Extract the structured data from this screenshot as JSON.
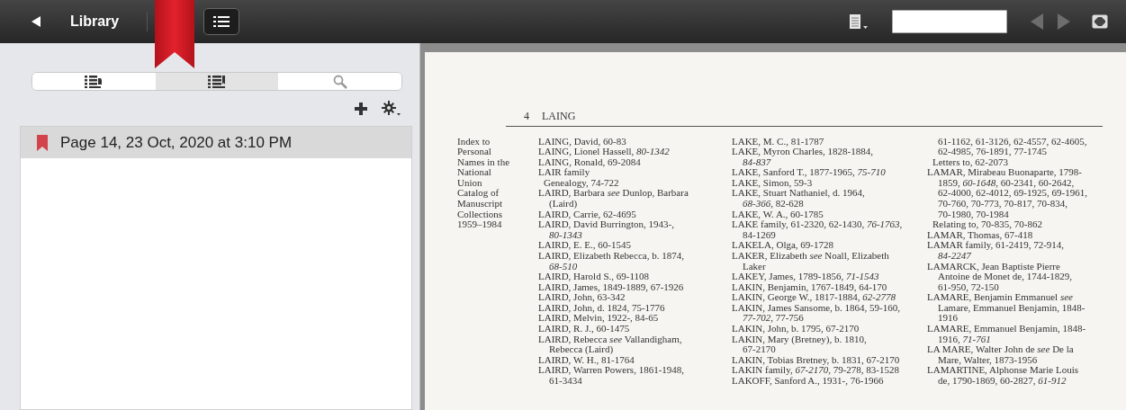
{
  "toolbar": {
    "title": "Library",
    "bookmark_ribbon": true,
    "nav_buttons": [
      {
        "kind": "prev",
        "disabled": true
      },
      {
        "kind": "next",
        "disabled": true
      }
    ]
  },
  "sidebar": {
    "tabs": [
      {
        "kind": "contents",
        "selected": false
      },
      {
        "kind": "bookmarks",
        "selected": true
      },
      {
        "kind": "search",
        "selected": false
      }
    ],
    "bookmarks": [
      {
        "label": "Page 14, 23 Oct, 2020 at 3:10 PM",
        "selected": true
      }
    ]
  },
  "page": {
    "running_head": {
      "number": "4",
      "word": "LAING"
    },
    "margin_note": [
      "Index to",
      "Personal",
      "Names in the",
      "National",
      "Union",
      "Catalog of",
      "Manuscript",
      "Collections",
      "1959–1984"
    ],
    "columns": [
      [
        {
          "kind": "entry",
          "lines": [
            "LAING, David, 60-83"
          ]
        },
        {
          "kind": "entry",
          "lines": [
            "LAING, Lionel Hassell, *80-1342*"
          ]
        },
        {
          "kind": "entry",
          "lines": [
            "LAING, Ronald, 69-2084"
          ]
        },
        {
          "kind": "entry",
          "lines": [
            "LAIR family"
          ]
        },
        {
          "kind": "sub",
          "lines": [
            "Genealogy, 74-722"
          ]
        },
        {
          "kind": "entry",
          "lines": [
            "LAIRD, Barbara *see* Dunlop, Barbara",
            "(Laird)"
          ]
        },
        {
          "kind": "entry",
          "lines": [
            "LAIRD, Carrie, 62-4695"
          ]
        },
        {
          "kind": "entry",
          "lines": [
            "LAIRD, David Burrington, 1943-,",
            "*80-1343*"
          ]
        },
        {
          "kind": "entry",
          "lines": [
            "LAIRD, E. E., 60-1545"
          ]
        },
        {
          "kind": "entry",
          "lines": [
            "LAIRD, Elizabeth Rebecca, b. 1874,",
            "*68-510*"
          ]
        },
        {
          "kind": "entry",
          "lines": [
            "LAIRD, Harold S., 69-1108"
          ]
        },
        {
          "kind": "entry",
          "lines": [
            "LAIRD, James, 1849-1889, 67-1926"
          ]
        },
        {
          "kind": "entry",
          "lines": [
            "LAIRD, John, 63-342"
          ]
        },
        {
          "kind": "entry",
          "lines": [
            "LAIRD, John, d. 1824, 75-1776"
          ]
        },
        {
          "kind": "entry",
          "lines": [
            "LAIRD, Melvin, 1922-, 84-65"
          ]
        },
        {
          "kind": "entry",
          "lines": [
            "LAIRD, R. J., 60-1475"
          ]
        },
        {
          "kind": "entry",
          "lines": [
            "LAIRD, Rebecca *see* Vallandigham,",
            "Rebecca (Laird)"
          ]
        },
        {
          "kind": "entry",
          "lines": [
            "LAIRD, W. H., 81-1764"
          ]
        },
        {
          "kind": "entry",
          "lines": [
            "LAIRD, Warren Powers, 1861-1948,",
            "61-3434"
          ]
        }
      ],
      [
        {
          "kind": "entry",
          "lines": [
            "LAKE, M. C., 81-1787"
          ]
        },
        {
          "kind": "entry",
          "lines": [
            "LAKE, Myron Charles, 1828-1884,",
            "*84-837*"
          ]
        },
        {
          "kind": "entry",
          "lines": [
            "LAKE, Sanford T., 1877-1965, *75-710*"
          ]
        },
        {
          "kind": "entry",
          "lines": [
            "LAKE, Simon, 59-3"
          ]
        },
        {
          "kind": "entry",
          "lines": [
            "LAKE, Stuart Nathaniel, d. 1964,",
            "*68-366*, 82-628"
          ]
        },
        {
          "kind": "entry",
          "lines": [
            "LAKE, W. A., 60-1785"
          ]
        },
        {
          "kind": "entry",
          "lines": [
            "LAKE family, 61-2320, 62-1430, *76-1763*,",
            "84-1269"
          ]
        },
        {
          "kind": "entry",
          "lines": [
            "LAKELA, Olga, 69-1728"
          ]
        },
        {
          "kind": "entry",
          "lines": [
            "LAKER, Elizabeth *see* Noall, Elizabeth",
            "Laker"
          ]
        },
        {
          "kind": "entry",
          "lines": [
            "LAKEY, James, 1789-1856, *71-1543*"
          ]
        },
        {
          "kind": "entry",
          "lines": [
            "LAKIN, Benjamin, 1767-1849, 64-170"
          ]
        },
        {
          "kind": "entry",
          "lines": [
            "LAKIN, George W., 1817-1884, *62-2778*"
          ]
        },
        {
          "kind": "entry",
          "lines": [
            "LAKIN, James Sansome, b. 1864, 59-160,",
            "*77-702*, 77-756"
          ]
        },
        {
          "kind": "entry",
          "lines": [
            "LAKIN, John, b. 1795, 67-2170"
          ]
        },
        {
          "kind": "entry",
          "lines": [
            "LAKIN, Mary (Bretney), b. 1810,",
            "67-2170"
          ]
        },
        {
          "kind": "entry",
          "lines": [
            "LAKIN, Tobias Bretney, b. 1831, 67-2170"
          ]
        },
        {
          "kind": "entry",
          "lines": [
            "LAKIN family, *67-2170*, 79-278, 83-1528"
          ]
        },
        {
          "kind": "entry",
          "lines": [
            "LAKOFF, Sanford A., 1931-, 76-1966"
          ]
        }
      ],
      [
        {
          "kind": "cont",
          "lines": [
            "61-1162, 61-3126, 62-4557, 62-4605,",
            "62-4985, 76-1891, 77-1745"
          ]
        },
        {
          "kind": "sub",
          "lines": [
            "Letters to, 62-2073"
          ]
        },
        {
          "kind": "entry",
          "lines": [
            "LAMAR, Mirabeau Buonaparte, 1798-",
            "1859, *60-1648*, 60-2341, 60-2642,",
            "62-4000, 62-4012, 69-1925, 69-1961,",
            "70-760, 70-773, 70-817, 70-834,",
            "70-1980, 70-1984"
          ]
        },
        {
          "kind": "sub",
          "lines": [
            "Relating to, 70-835, 70-862"
          ]
        },
        {
          "kind": "entry",
          "lines": [
            "LAMAR, Thomas, 67-418"
          ]
        },
        {
          "kind": "entry",
          "lines": [
            "LAMAR family, 61-2419, 72-914,",
            "*84-2247*"
          ]
        },
        {
          "kind": "entry",
          "lines": [
            "LAMARCK, Jean Baptiste Pierre",
            "Antoine de Monet de, 1744-1829,",
            "61-950, 72-150"
          ]
        },
        {
          "kind": "entry",
          "lines": [
            "LAMARE, Benjamin Emmanuel *see*",
            "Lamare, Emmanuel Benjamin, 1848-",
            "1916"
          ]
        },
        {
          "kind": "entry",
          "lines": [
            "LAMARE, Emmanuel Benjamin, 1848-",
            "1916, *71-761*"
          ]
        },
        {
          "kind": "entry",
          "lines": [
            "LA MARE, Walter John de *see* De la",
            "Mare, Walter, 1873-1956"
          ]
        },
        {
          "kind": "entry",
          "lines": [
            "LAMARTINE, Alphonse Marie Louis",
            "de, 1790-1869, 60-2827, *61-912*"
          ]
        }
      ]
    ]
  }
}
